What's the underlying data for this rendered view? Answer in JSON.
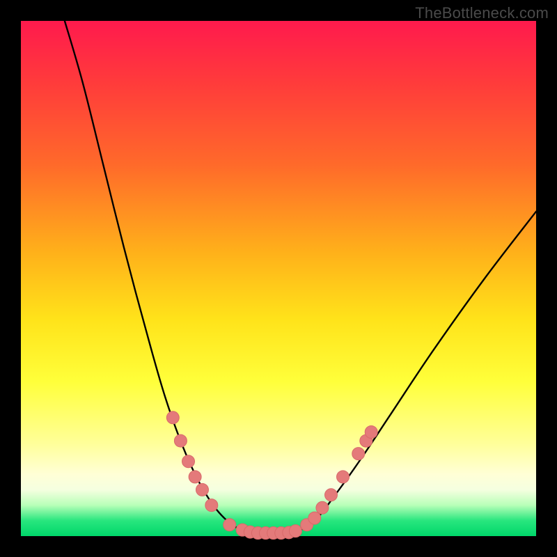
{
  "watermark": "TheBottleneck.com",
  "colors": {
    "curve_stroke": "#000000",
    "marker_fill": "#e47a7a",
    "marker_stroke": "#d86a6a"
  },
  "chart_data": {
    "type": "line",
    "title": "",
    "xlabel": "",
    "ylabel": "",
    "xlim": [
      0,
      100
    ],
    "ylim": [
      0,
      100
    ],
    "curve": {
      "left": [
        {
          "x": 8.5,
          "y": 100
        },
        {
          "x": 12,
          "y": 88
        },
        {
          "x": 16,
          "y": 72
        },
        {
          "x": 20,
          "y": 56
        },
        {
          "x": 24,
          "y": 41
        },
        {
          "x": 28,
          "y": 27
        },
        {
          "x": 32,
          "y": 16
        },
        {
          "x": 36,
          "y": 8
        },
        {
          "x": 40,
          "y": 3
        },
        {
          "x": 44,
          "y": 0.7
        }
      ],
      "bottom": [
        {
          "x": 44,
          "y": 0.7
        },
        {
          "x": 47,
          "y": 0.5
        },
        {
          "x": 50,
          "y": 0.5
        },
        {
          "x": 53,
          "y": 0.7
        }
      ],
      "right": [
        {
          "x": 53,
          "y": 0.7
        },
        {
          "x": 57,
          "y": 3
        },
        {
          "x": 61,
          "y": 8
        },
        {
          "x": 66,
          "y": 15
        },
        {
          "x": 72,
          "y": 24
        },
        {
          "x": 80,
          "y": 36
        },
        {
          "x": 90,
          "y": 50
        },
        {
          "x": 100,
          "y": 63
        }
      ]
    },
    "markers": [
      {
        "x": 29.5,
        "y": 23
      },
      {
        "x": 31,
        "y": 18.5
      },
      {
        "x": 32.5,
        "y": 14.5
      },
      {
        "x": 33.8,
        "y": 11.5
      },
      {
        "x": 35.2,
        "y": 9
      },
      {
        "x": 37,
        "y": 6
      },
      {
        "x": 40.5,
        "y": 2.2
      },
      {
        "x": 43,
        "y": 1.2
      },
      {
        "x": 44.5,
        "y": 0.8
      },
      {
        "x": 46,
        "y": 0.6
      },
      {
        "x": 47.5,
        "y": 0.6
      },
      {
        "x": 49,
        "y": 0.6
      },
      {
        "x": 50.5,
        "y": 0.6
      },
      {
        "x": 52,
        "y": 0.7
      },
      {
        "x": 53.3,
        "y": 1.0
      },
      {
        "x": 55.5,
        "y": 2.2
      },
      {
        "x": 57,
        "y": 3.5
      },
      {
        "x": 58.5,
        "y": 5.5
      },
      {
        "x": 60.2,
        "y": 8
      },
      {
        "x": 62.5,
        "y": 11.5
      },
      {
        "x": 65.5,
        "y": 16
      },
      {
        "x": 67,
        "y": 18.5
      },
      {
        "x": 68,
        "y": 20.2
      }
    ]
  }
}
